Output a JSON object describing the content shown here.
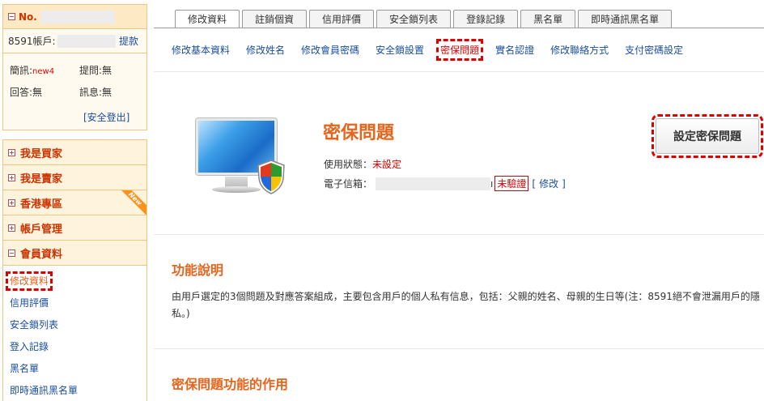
{
  "sidebar": {
    "user_no_label": "No.",
    "account_label": "8591帳戶:",
    "withdraw_link": "提款",
    "stats": {
      "message_label": "簡訊:",
      "message_value": "new4",
      "question_label": "提問:",
      "question_value": "無",
      "reply_label": "回答:",
      "reply_value": "無",
      "notice_label": "訊息:",
      "notice_value": "無"
    },
    "logout": "[安全登出]",
    "menu": [
      {
        "label": "我是買家"
      },
      {
        "label": "我是賣家"
      },
      {
        "label": "香港專區",
        "badge": "New"
      },
      {
        "label": "帳戶管理"
      },
      {
        "label": "會員資料"
      }
    ],
    "sub_items": [
      {
        "label": "修改資料"
      },
      {
        "label": "信用評價"
      },
      {
        "label": "安全鎖列表"
      },
      {
        "label": "登入記錄"
      },
      {
        "label": "黑名單"
      },
      {
        "label": "即時通訊黑名單"
      }
    ]
  },
  "tabs": [
    {
      "label": "修改資料"
    },
    {
      "label": "註銷個資"
    },
    {
      "label": "信用評價"
    },
    {
      "label": "安全鎖列表"
    },
    {
      "label": "登錄記錄"
    },
    {
      "label": "黑名單"
    },
    {
      "label": "即時通訊黑名單"
    }
  ],
  "subnav": [
    {
      "label": "修改基本資料"
    },
    {
      "label": "修改姓名"
    },
    {
      "label": "修改會員密碼"
    },
    {
      "label": "安全鎖設置"
    },
    {
      "label": "密保問題"
    },
    {
      "label": "實名認證"
    },
    {
      "label": "修改聯絡方式"
    },
    {
      "label": "支付密碼設定"
    }
  ],
  "main": {
    "title": "密保問題",
    "status_label": "使用狀態：",
    "status_value": "未設定",
    "email_label": "電子信箱：",
    "email_suffix": "ı",
    "unverified": "未驗證",
    "edit_open": "[",
    "edit_link": "修改",
    "edit_close": "]",
    "set_button": "設定密保問題",
    "section1_title": "功能說明",
    "section1_text": "由用戶選定的3個問題及對應答案組成，主要包含用戶的個人私有信息，包括：父親的姓名、母親的生日等(注：8591絕不會泄漏用戶的隱私。)",
    "section2_title": "密保問題功能的作用"
  },
  "colors": {
    "accent": "#e8641b",
    "link": "#1a4ea0",
    "highlight": "#dd0000",
    "sidebar_bg": "#fef3dd"
  }
}
